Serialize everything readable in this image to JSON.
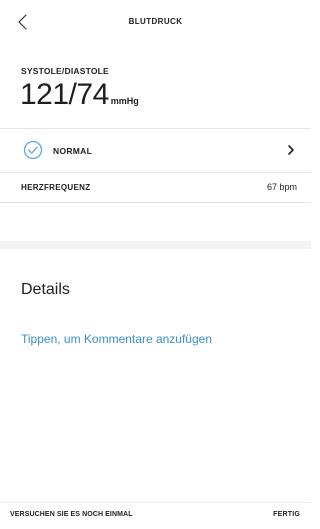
{
  "header": {
    "back_icon": "chevron-left-icon",
    "title": "BLUTDRUCK"
  },
  "measurement": {
    "label": "SYSTOLE/DIASTOLE",
    "value": "121/74",
    "unit": "mmHg"
  },
  "status": {
    "icon": "check-circle-icon",
    "label": "NORMAL",
    "chevron_icon": "chevron-right-icon",
    "color": "#5fa9d6"
  },
  "heart_rate": {
    "label": "HERZFREQUENZ",
    "value": "67 bpm"
  },
  "details": {
    "title": "Details",
    "comment_link": "Tippen, um Kommentare anzufügen",
    "link_color": "#3d8fc4"
  },
  "footer": {
    "retry_label": "VERSUCHEN SIE ES NOCH EINMAL",
    "done_label": "FERTIG"
  }
}
